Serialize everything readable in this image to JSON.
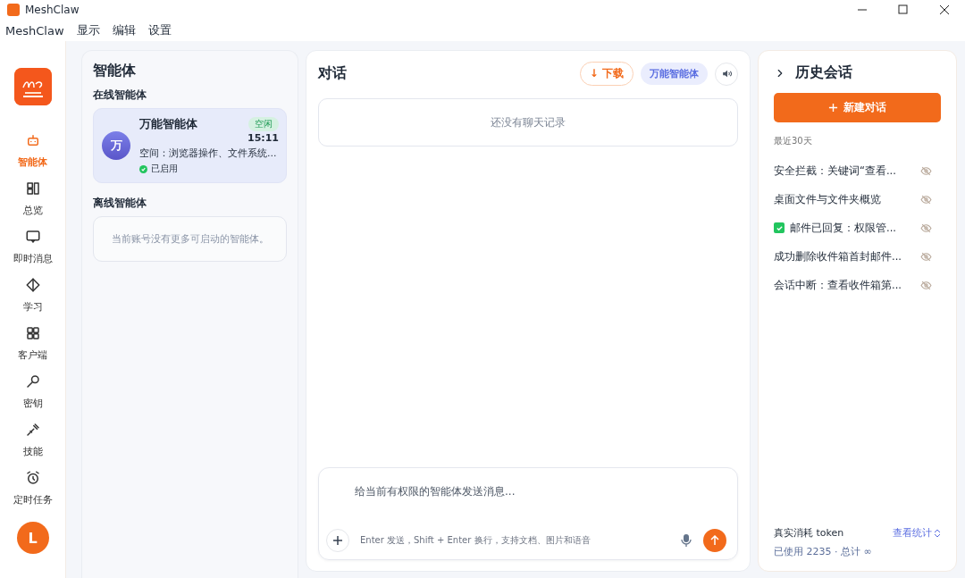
{
  "window": {
    "title": "MeshClaw"
  },
  "menu": [
    "MeshClaw",
    "显示",
    "编辑",
    "设置"
  ],
  "nav": [
    {
      "label": "智能体",
      "selected": true
    },
    {
      "label": "总览",
      "selected": false
    },
    {
      "label": "即时消息",
      "selected": false
    },
    {
      "label": "学习",
      "selected": false
    },
    {
      "label": "客户端",
      "selected": false
    },
    {
      "label": "密钥",
      "selected": false
    },
    {
      "label": "技能",
      "selected": false
    },
    {
      "label": "定时任务",
      "selected": false
    }
  ],
  "user_avatar": "L",
  "agents": {
    "title": "智能体",
    "online_heading": "在线智能体",
    "online": [
      {
        "avatar": "万",
        "name": "万能智能体",
        "badge": "空闲",
        "time": "15:11",
        "desc": "空间：浏览器操作、文件系统...",
        "status": "已启用",
        "enabled": true,
        "selected": true
      }
    ],
    "offline_heading": "离线智能体",
    "offline_empty": "当前账号没有更多可启动的智能体。"
  },
  "chat": {
    "title": "对话",
    "download": "↓ 下载",
    "agent_chip": "万能智能体",
    "empty": "还没有聊天记录",
    "placeholder": "给当前有权限的智能体发送消息...",
    "hint": "Enter 发送，Shift + Enter 换行，支持文档、图片和语音"
  },
  "history": {
    "title": "历史会话",
    "new_button": "新建对话",
    "section": "最近30天",
    "items": [
      {
        "title": "安全拦截：关键词“查看...",
        "checked": false
      },
      {
        "title": "桌面文件与文件夹概览",
        "checked": false
      },
      {
        "title": "邮件已回复：权限管...",
        "checked": true
      },
      {
        "title": "成功删除收件箱首封邮件...",
        "checked": false
      },
      {
        "title": "会话中断：查看收件箱第...",
        "checked": false
      }
    ],
    "usage_label": "真实消耗 token",
    "usage_link": "查看统计",
    "usage": "已使用 2235 · 总计 ∞"
  }
}
